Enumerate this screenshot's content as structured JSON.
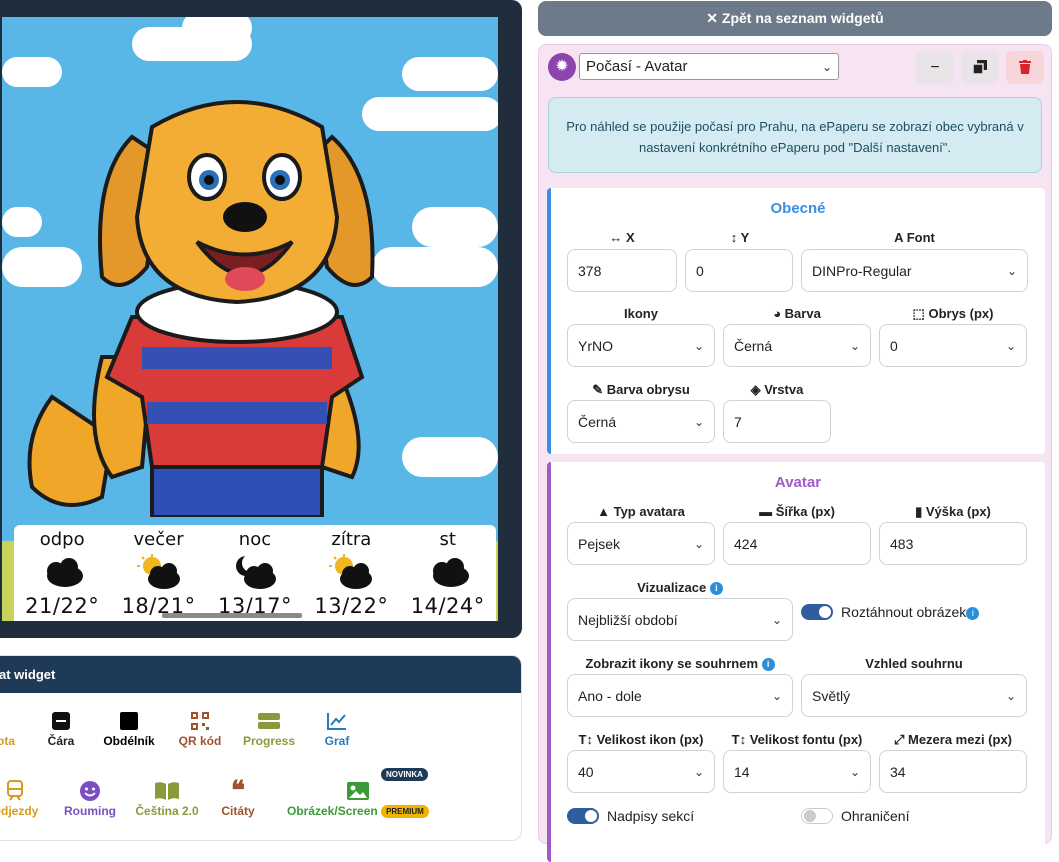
{
  "preview": {
    "weather": [
      {
        "label": "odpo",
        "temp": "21/22°",
        "icon": "cloud-icon"
      },
      {
        "label": "večer",
        "temp": "18/21°",
        "icon": "sun-cloud-icon"
      },
      {
        "label": "noc",
        "temp": "13/17°",
        "icon": "moon-cloud-icon"
      },
      {
        "label": "zítra",
        "temp": "13/22°",
        "icon": "sun-cloud-icon"
      },
      {
        "label": "st",
        "temp": "14/24°",
        "icon": "cloud-icon"
      }
    ]
  },
  "add_widget": {
    "title": "at widget",
    "tools": [
      {
        "label": "ota",
        "color": "#d99a1f",
        "icon": "partial-icon"
      },
      {
        "label": "Čára",
        "color": "#222222",
        "icon": "line-icon"
      },
      {
        "label": "Obdélník",
        "color": "#000000",
        "icon": "rectangle-icon"
      },
      {
        "label": "QR kód",
        "color": "#a0522d",
        "icon": "qr-icon"
      },
      {
        "label": "Progress",
        "color": "#8a9a3b",
        "icon": "progress-icon"
      },
      {
        "label": "Graf",
        "color": "#2b7bb9",
        "icon": "chart-icon"
      },
      {
        "label": "Odjezdy",
        "color": "#d99a1f",
        "icon": "train-icon"
      },
      {
        "label": "Rouming",
        "color": "#7b4fc0",
        "icon": "smile-icon"
      },
      {
        "label": "Čeština 2.0",
        "color": "#8a9a3b",
        "icon": "book-icon"
      },
      {
        "label": "Citáty",
        "color": "#a0522d",
        "icon": "quote-icon"
      },
      {
        "label": "Obrázek/Screen",
        "color": "#3a9a3a",
        "icon": "image-icon"
      }
    ],
    "badge_new": "NOVINKA",
    "badge_premium": "PREMIUM"
  },
  "back_button": "✕ Zpět na seznam widgetů",
  "editor": {
    "widget_select": "Počasí - Avatar",
    "info_text": "Pro náhled se použije počasí pro Prahu, na ePaperu se zobrazí obec vybraná v nastavení konkrétního ePaperu pod \"Další nastavení\".",
    "general": {
      "title": "Obecné",
      "x_label": "X",
      "x_value": "378",
      "y_label": "Y",
      "y_value": "0",
      "font_label": "Font",
      "font_value": "DINPro-Regular",
      "icons_label": "Ikony",
      "icons_value": "YrNO",
      "color_label": "Barva",
      "color_value": "Černá",
      "outline_label": "Obrys (px)",
      "outline_value": "0",
      "outline_color_label": "Barva obrysu",
      "outline_color_value": "Černá",
      "layer_label": "Vrstva",
      "layer_value": "7"
    },
    "avatar": {
      "title": "Avatar",
      "type_label": "Typ avatara",
      "type_value": "Pejsek",
      "width_label": "Šířka (px)",
      "width_value": "424",
      "height_label": "Výška (px)",
      "height_value": "483",
      "viz_label": "Vizualizace",
      "viz_value": "Nejbližší období",
      "stretch_label": "Roztáhnout obrázek",
      "summary_icons_label": "Zobrazit ikony se souhrnem",
      "summary_icons_value": "Ano - dole",
      "summary_look_label": "Vzhled souhrnu",
      "summary_look_value": "Světlý",
      "icon_size_label": "Velikost ikon (px)",
      "icon_size_value": "40",
      "font_size_label": "Velikost fontu (px)",
      "font_size_value": "14",
      "gap_label": "Mezera mezi (px)",
      "gap_value": "34",
      "section_titles_label": "Nadpisy sekcí",
      "border_label": "Ohraničení"
    }
  },
  "colors": {
    "accent_blue": "#3a8ee6",
    "accent_purple": "#a25bc6",
    "toggle_on": "#2f5d9e"
  }
}
